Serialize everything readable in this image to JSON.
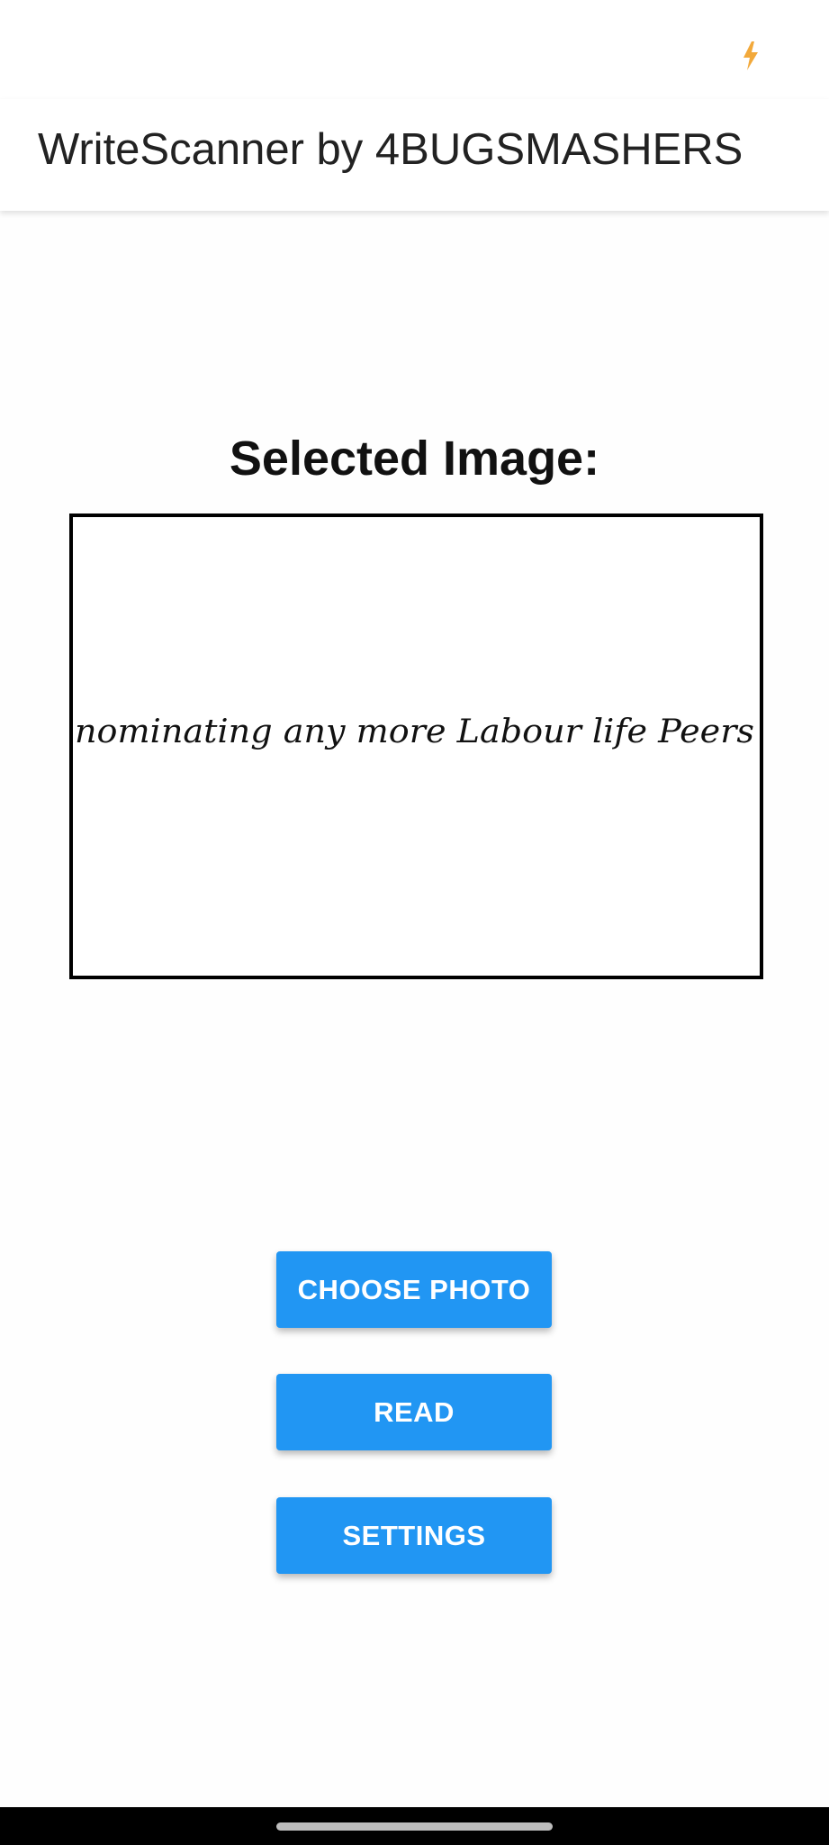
{
  "status_bar": {
    "icon": "flash-bolt-icon",
    "icon_color": "#f2a93b"
  },
  "app_bar": {
    "title": "WriteScanner by 4BUGSMASHERS"
  },
  "main": {
    "heading": "Selected Image:",
    "image_text": "nominating any more Labour life Peers",
    "buttons": {
      "choose_photo": "CHOOSE PHOTO",
      "read": "READ",
      "settings": "SETTINGS"
    }
  },
  "colors": {
    "button": "#2196f3",
    "button_text": "#ffffff",
    "nav_bar": "#000000"
  }
}
